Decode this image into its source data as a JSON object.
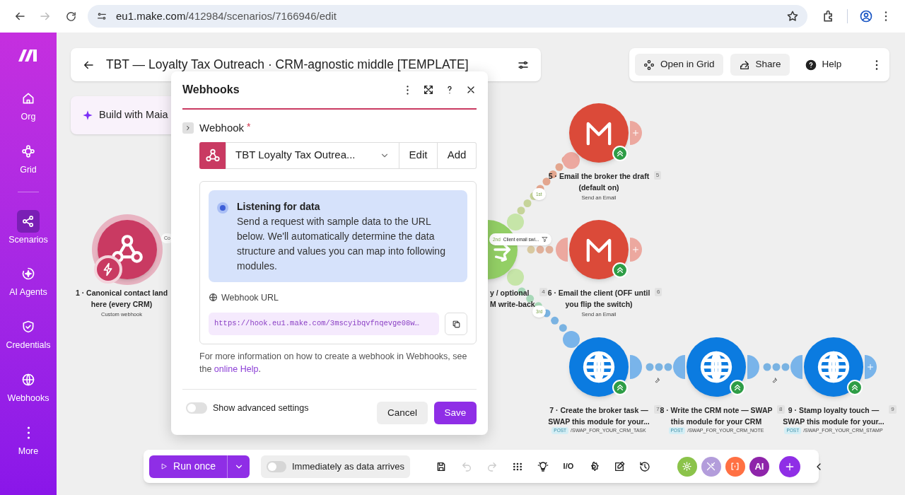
{
  "browser": {
    "url_host": "eu1.make.com",
    "url_path": "/412984/scenarios/7166946/edit",
    "forward_disabled": true
  },
  "sidebar": {
    "items": [
      {
        "label": "Org",
        "selected": false
      },
      {
        "label": "Grid",
        "selected": false
      },
      {
        "label": "Scenarios",
        "selected": true
      },
      {
        "label": "AI Agents",
        "selected": false
      },
      {
        "label": "Credentials",
        "selected": false
      },
      {
        "label": "Webhooks",
        "selected": false
      },
      {
        "label": "More",
        "selected": false
      }
    ]
  },
  "scenario": {
    "title": "TBT — Loyalty Tax Outreach · CRM-agnostic middle [TEMPLATE]"
  },
  "top_actions": [
    {
      "label": "Open in Grid"
    },
    {
      "label": "Share"
    },
    {
      "label": "Help"
    }
  ],
  "maia": {
    "label": "Build with Maia"
  },
  "modal": {
    "title": "Webhooks",
    "field_label": "Webhook",
    "required_mark": "*",
    "webhook_value": "TBT Loyalty Tax Outrea...",
    "edit": "Edit",
    "add": "Add",
    "listening_title": "Listening for data",
    "listening_text": "Send a request with sample data to the URL below. We'll automatically determine the data structure and values you can map into following modules.",
    "url_label": "Webhook URL",
    "url": "https://hook.eu1.make.com/3mscyibqvfnqevge08w…",
    "help_before": "For more information on how to create a webhook in Webhooks, see the ",
    "help_link": "online Help",
    "help_after": ".",
    "advanced": {
      "label": "Show advanced settings",
      "on": false
    },
    "cancel": "Cancel",
    "save": "Save"
  },
  "nodes": [
    {
      "kind": "webhook",
      "title_lines": [
        "1 · Canonical contact land",
        "here (every CRM)"
      ],
      "subtitle": "Custom webhook",
      "bubble": "Co"
    },
    {
      "kind": "router",
      "title_lines": [
        "y / optional",
        "M write-back"
      ],
      "badge": "4"
    },
    {
      "kind": "email",
      "title_lines": [
        "5 · Email the broker the draft",
        "(default on)"
      ],
      "badge": "5",
      "subtitle": "Send an Email"
    },
    {
      "kind": "email",
      "title_lines": [
        "6 · Email the client (OFF until",
        "you flip the switch)"
      ],
      "badge": "6",
      "subtitle": "Send an Email"
    },
    {
      "kind": "http",
      "title_lines": [
        "7 · Create the broker task —",
        "SWAP this module for your..."
      ],
      "badge": "7",
      "method": "POST",
      "subtitle": "/SWAP_FOR_YOUR_CRM_TASK"
    },
    {
      "kind": "http",
      "title_lines": [
        "8 · Write the CRM note — SWAP",
        "this module for your CRM"
      ],
      "badge": "8",
      "method": "POST",
      "subtitle": "/SWAP_FOR_YOUR_CRM_NOTE"
    },
    {
      "kind": "http",
      "title_lines": [
        "9 · Stamp loyalty touch —",
        "SWAP this module for your..."
      ],
      "badge": "9",
      "method": "POST",
      "subtitle": "/SWAP_FOR_YOUR_CRM_STAMP"
    }
  ],
  "routes": [
    {
      "label": "1st"
    },
    {
      "label": "2nd",
      "filter": "Client email swi..."
    },
    {
      "label": "3rd"
    }
  ],
  "toolbar": {
    "run": "Run once",
    "schedule": {
      "label": "Immediately as data arrives",
      "on": false
    },
    "tools": [
      {
        "disabled": false
      },
      {
        "disabled": true
      },
      {
        "disabled": true
      },
      {
        "disabled": false
      },
      {
        "disabled": false
      },
      {
        "disabled": false,
        "text": "I/O"
      },
      {
        "disabled": false
      },
      {
        "disabled": false
      },
      {
        "disabled": false
      }
    ],
    "apps": [
      {
        "color": "#8bc34a"
      },
      {
        "color": "#b39ddb"
      },
      {
        "color": "#ff7043"
      },
      {
        "color": "#8e24aa",
        "text": "AI"
      }
    ]
  }
}
